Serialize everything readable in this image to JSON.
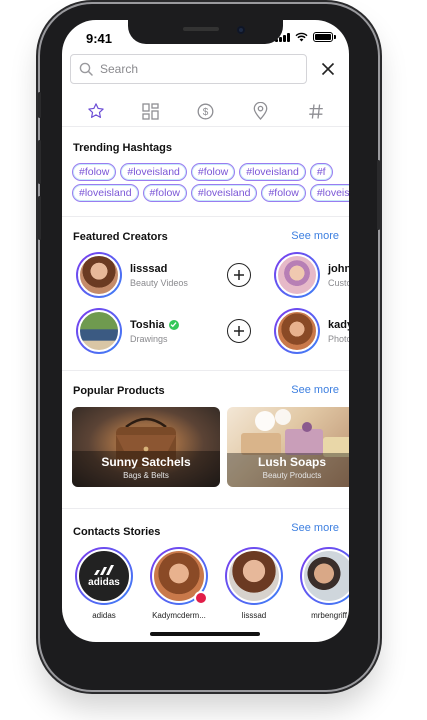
{
  "status": {
    "time": "9:41"
  },
  "search": {
    "placeholder": "Search"
  },
  "tabs": [
    {
      "icon": "star-icon"
    },
    {
      "icon": "grid-icon"
    },
    {
      "icon": "dollar-icon"
    },
    {
      "icon": "location-pin-icon"
    },
    {
      "icon": "hashtag-icon"
    }
  ],
  "trending": {
    "title": "Trending Hashtags",
    "row1": [
      "#folow",
      "#loveisland",
      "#folow",
      "#loveisland",
      "#f"
    ],
    "row2": [
      "#loveisland",
      "#folow",
      "#loveisland",
      "#folow",
      "#loveisland"
    ]
  },
  "creators": {
    "title": "Featured Creators",
    "see_more": "See more",
    "items": [
      {
        "name": "lisssad",
        "sub": "Beauty Videos"
      },
      {
        "name": "john",
        "sub": "Custo"
      },
      {
        "name": "Toshia",
        "sub": "Drawings",
        "verified": true
      },
      {
        "name": "kady",
        "sub": "Photo"
      }
    ]
  },
  "products": {
    "title": "Popular Products",
    "see_more": "See more",
    "items": [
      {
        "name": "Sunny Satchels",
        "sub": "Bags & Belts"
      },
      {
        "name": "Lush Soaps",
        "sub": "Beauty Products"
      }
    ]
  },
  "stories": {
    "title": "Contacts Stories",
    "see_more": "See more",
    "items": [
      {
        "label": "adidas",
        "logo": "adidas"
      },
      {
        "label": "Kadymcderm..."
      },
      {
        "label": "lisssad"
      },
      {
        "label": "mrbengriff"
      }
    ]
  },
  "colors": {
    "accent": "#3d7fe0",
    "ring_start": "#7c3aed",
    "ring_end": "#3b82f6",
    "tag_border": "#9a7cf0"
  }
}
